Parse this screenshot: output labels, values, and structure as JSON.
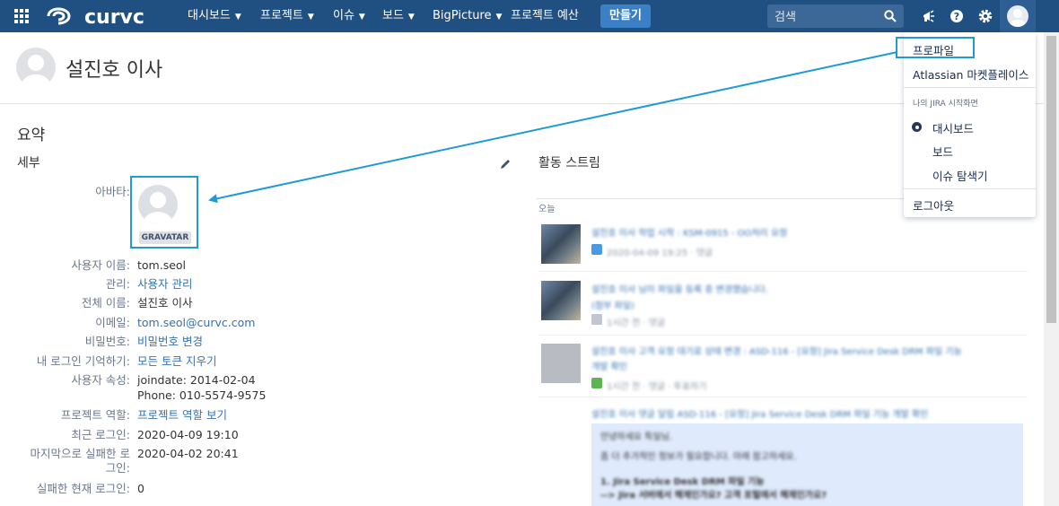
{
  "topnav": {
    "logo_text": "curvc",
    "items": [
      {
        "label": "대시보드",
        "has_caret": true
      },
      {
        "label": "프로젝트",
        "has_caret": true
      },
      {
        "label": "이슈",
        "has_caret": true
      },
      {
        "label": "보드",
        "has_caret": true
      },
      {
        "label": "BigPicture",
        "has_caret": true
      },
      {
        "label": "프로젝트 예산",
        "has_caret": false
      }
    ],
    "create_label": "만들기",
    "search_placeholder": "검색"
  },
  "header": {
    "user_title": "설진호 이사"
  },
  "summary": {
    "section_title": "요약",
    "details_title": "세부",
    "avatar_label": "아바타:",
    "gravatar_badge": "GRAVATAR",
    "rows": [
      {
        "label": "사용자 이름:",
        "value": "tom.seol"
      },
      {
        "label": "관리:",
        "value": "사용자 관리"
      },
      {
        "label": "전체 이름:",
        "value": "설진호 이사"
      },
      {
        "label": "이메일:",
        "value": "tom.seol@curvc.com"
      },
      {
        "label": "비밀번호:",
        "value": "비밀번호 변경"
      },
      {
        "label": "내 로그인 기억하기:",
        "value": "모든 토큰 지우기"
      },
      {
        "label": "사용자 속성:",
        "value": "joindate: 2014-02-04",
        "value2": "Phone: 010-5574-9575"
      },
      {
        "label": "프로젝트 역할:",
        "value": "프로젝트 역할 보기"
      },
      {
        "label": "최근 로그인:",
        "value": "2020-04-09 19:10"
      },
      {
        "label": "마지막으로 실패한 로",
        "label2": "그인:",
        "value": "2020-04-02 20:41"
      },
      {
        "label": "실패한 현재 로그인:",
        "value": "0"
      }
    ]
  },
  "activity": {
    "title": "활동 스트림",
    "today_label": "오늘",
    "entries": [
      {
        "line1": "설진호 이사 작업 시작 : KSM-0915 - OO처리 요청",
        "meta": "2020-04-09 19:25 · 댓글"
      },
      {
        "line1": "설진호 이사 님이 파일을 등록 중 변경했습니다.",
        "line2": "(첨부 파일)",
        "meta": "1시간 전 · 댓글"
      },
      {
        "line1": "설진호 이사 고객 요청 대기로 상태 변경 : ASD-116 - [요청] Jira Service Desk DRM 파일 기능",
        "line2": "개발 확인",
        "meta": "1시간 전 · 댓글 · 투표하기"
      },
      {
        "line1": "설진호 이사 댓글 달림 ASD-116 - [요청] Jira Service Desk DRM 파일 기능 개발 확인"
      }
    ],
    "quote_lines": [
      "안녕하세요 특일님.",
      "좀 더 추가적인 정보가 필요합니다. 아래 참고하세요.",
      "1. Jira Service Desk DRM 파일 기능",
      "--> Jira 서버에서 해제인가요? 고객 포털에서 해제인가요?"
    ]
  },
  "dropdown": {
    "profile": "프로파일",
    "marketplace": "Atlassian 마켓플레이스",
    "start_heading": "나의 JIRA 시작화면",
    "options": [
      "대시보드",
      "보드",
      "이슈 탐색기"
    ],
    "selected_option": "대시보드",
    "logout": "로그아웃"
  },
  "colors": {
    "nav_bg": "#205081",
    "create_btn": "#3b7fc4",
    "link": "#3572b0",
    "highlight": "#1e9ad6"
  }
}
